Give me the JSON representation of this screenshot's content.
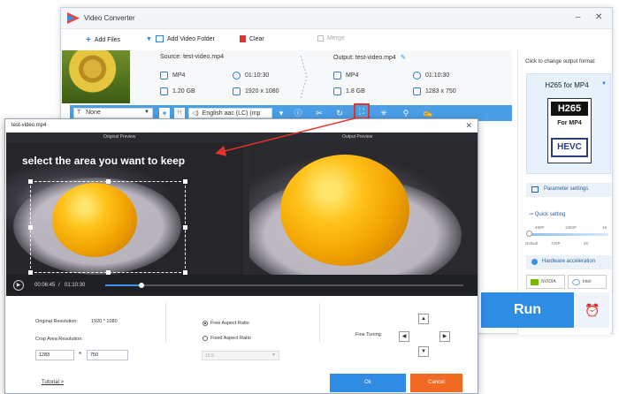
{
  "app": {
    "title": "Video Converter"
  },
  "toolbar": {
    "add_files": "Add Files",
    "add_folder": "Add Video Folder",
    "clear": "Clear",
    "merge": "Merge"
  },
  "file": {
    "source_label": "Source: test-video.mp4",
    "output_label": "Output: test-video.mp4",
    "source": {
      "format": "MP4",
      "duration": "01:10:30",
      "size": "1.20 GB",
      "resolution": "1920 x 1080"
    },
    "output": {
      "format": "MP4",
      "duration": "01:10:30",
      "size": "1.8 GB",
      "resolution": "1283 x 750"
    }
  },
  "edit_toolbar": {
    "subtitle": "None",
    "audio": "English aac (LC) (mp"
  },
  "right_panel": {
    "format_title": "Click to change output format:",
    "format_name": "H265 for MP4",
    "format_img": {
      "top": "H265",
      "mid": "For MP4",
      "bottom": "HEVC"
    },
    "param_settings": "Parameter settings",
    "quick_setting": "Quick setting",
    "qs_top": [
      "480P",
      "1080P",
      "4K"
    ],
    "qs_bottom": [
      "Default",
      "720P",
      "2K"
    ],
    "hw_accel": "Hardware acceleration",
    "nvidia": "NVIDIA",
    "intel": "Intel",
    "run": "Run"
  },
  "crop_dialog": {
    "title": "test-video.mp4",
    "original_preview": "Original Preview",
    "output_preview": "Output Preview",
    "caption": "select the area you want to keep",
    "time_current": "00:06:45",
    "time_sep": "/",
    "time_total": "01:10:30",
    "progress": 0.1,
    "original_resolution_label": "Original Resolution:",
    "original_resolution_value": "1920 * 1080",
    "crop_resolution_label": "Crop Area Resolution:",
    "crop_width": "1283",
    "crop_x": "*",
    "crop_height": "750",
    "free_aspect": "Free Aspect Ratio",
    "fixed_aspect": "Fixed Aspect Ratio",
    "ratio_value": "16:9",
    "fine_tuning": "Fine Tuning:",
    "tutorial": "Tutorial >",
    "ok": "Ok",
    "cancel": "Cancel"
  },
  "colors": {
    "accent": "#2f8ce5",
    "highlight": "#e4332b",
    "cancel": "#f06a23"
  }
}
